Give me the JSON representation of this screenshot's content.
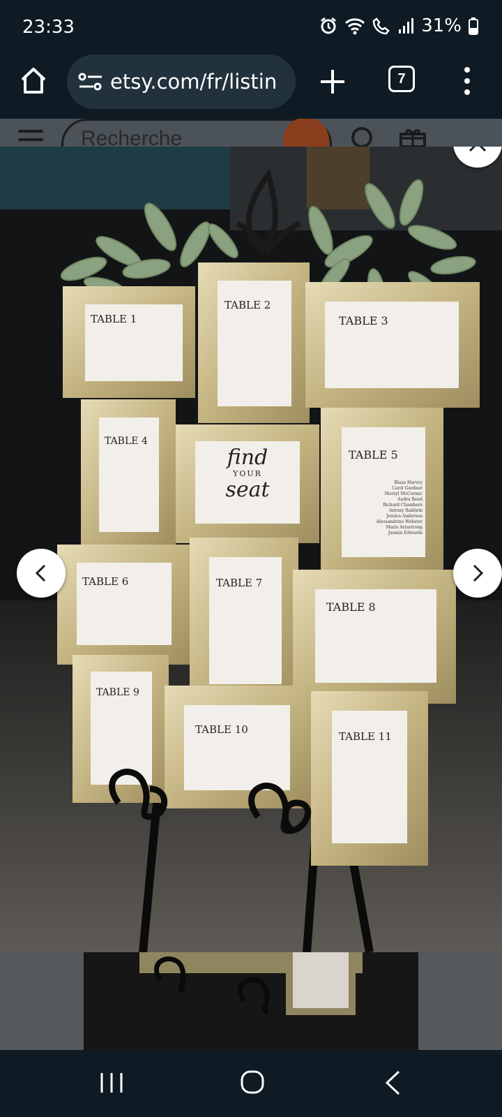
{
  "status_bar": {
    "time": "23:33",
    "battery": "31%"
  },
  "browser": {
    "url": "etsy.com/fr/listin",
    "tab_count": "7"
  },
  "etsy": {
    "search_placeholder": "Recherche"
  },
  "photo": {
    "center_card": {
      "line1": "find",
      "line2": "YOUR",
      "line3": "seat"
    },
    "tables": [
      {
        "word": "TABLE",
        "number": "1"
      },
      {
        "word": "TABLE",
        "number": "2"
      },
      {
        "word": "TABLE",
        "number": "3"
      },
      {
        "word": "TABLE",
        "number": "4"
      },
      {
        "word": "TABLE",
        "number": "5"
      },
      {
        "word": "TABLE",
        "number": "6"
      },
      {
        "word": "TABLE",
        "number": "7"
      },
      {
        "word": "TABLE",
        "number": "8"
      },
      {
        "word": "TABLE",
        "number": "9"
      },
      {
        "word": "TABLE",
        "number": "10"
      },
      {
        "word": "TABLE",
        "number": "11"
      }
    ],
    "guest_names": [
      "Blaze Harvey",
      "Carol Gardner",
      "Merryl McCormic",
      "Audra Reed",
      "Richard Chambers",
      "Antony Baldwin",
      "Jessica Anderson",
      "Alessandrina Webster",
      "Marie Armstrong",
      "Jasmin Edwards"
    ]
  },
  "icons": {
    "home": "home-icon",
    "site_info": "site-settings-icon",
    "new_tab": "plus-icon",
    "menu": "more-vert-icon",
    "close": "close-icon",
    "prev": "chevron-left-icon",
    "next": "chevron-right-icon",
    "recent": "recent-apps-icon",
    "nav_home": "circle-home-icon",
    "back": "back-icon"
  },
  "colors": {
    "chrome_bg": "#0e1b24",
    "url_pill": "#22323d",
    "frame_gold": "#cdbd8f"
  }
}
